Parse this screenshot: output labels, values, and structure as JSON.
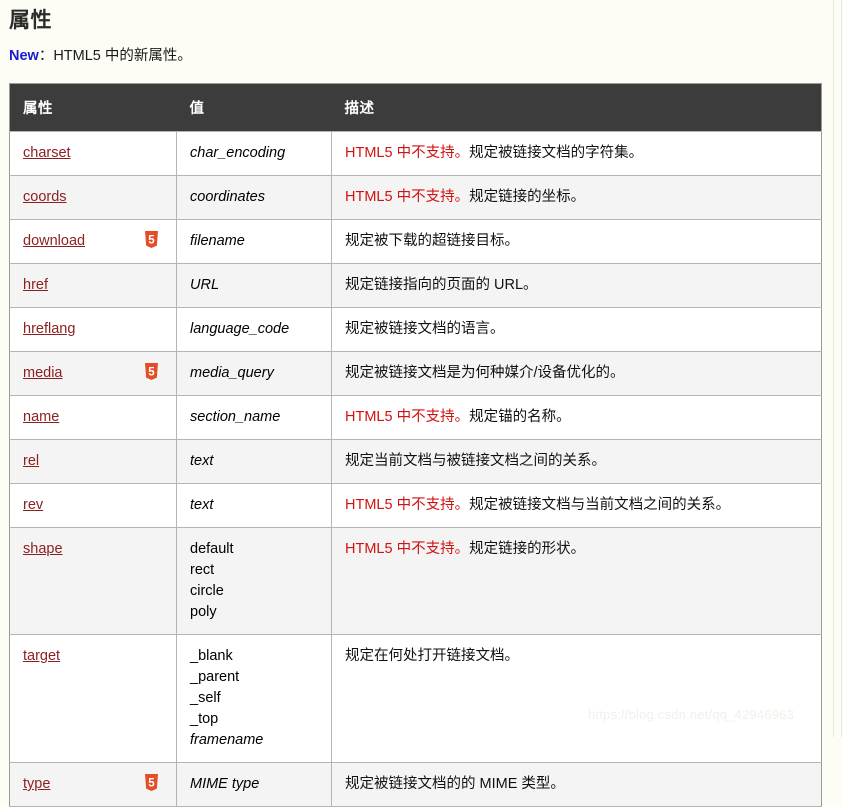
{
  "page": {
    "title": "属性",
    "new_badge": "New",
    "new_note": "：HTML5 中的新属性。",
    "watermark": "https://blog.csdn.net/qq_42946963",
    "accent_link_color": "#8c1f1f",
    "header_bg_color": "#3c3c3c",
    "not_supported_color": "#d11212",
    "new_badge_color": "#1a1ad0",
    "html5_badge_color": "#e44d26",
    "page_bg_color": "#fdfdf6"
  },
  "table": {
    "columns": [
      "属性",
      "值",
      "描述"
    ],
    "rows": [
      {
        "attr": "charset",
        "html5": false,
        "values": [
          {
            "text": "char_encoding",
            "italic": true
          }
        ],
        "ns": "HTML5 中不支持。",
        "desc": "规定被链接文档的字符集。"
      },
      {
        "attr": "coords",
        "html5": false,
        "values": [
          {
            "text": "coordinates",
            "italic": true
          }
        ],
        "ns": "HTML5 中不支持。",
        "desc": "规定链接的坐标。"
      },
      {
        "attr": "download",
        "html5": true,
        "values": [
          {
            "text": "filename",
            "italic": true
          }
        ],
        "ns": "",
        "desc": "规定被下载的超链接目标。"
      },
      {
        "attr": "href",
        "html5": false,
        "values": [
          {
            "text": "URL",
            "italic": true
          }
        ],
        "ns": "",
        "desc": "规定链接指向的页面的 URL。"
      },
      {
        "attr": "hreflang",
        "html5": false,
        "values": [
          {
            "text": "language_code",
            "italic": true
          }
        ],
        "ns": "",
        "desc": "规定被链接文档的语言。"
      },
      {
        "attr": "media",
        "html5": true,
        "values": [
          {
            "text": "media_query",
            "italic": true
          }
        ],
        "ns": "",
        "desc": "规定被链接文档是为何种媒介/设备优化的。"
      },
      {
        "attr": "name",
        "html5": false,
        "values": [
          {
            "text": "section_name",
            "italic": true
          }
        ],
        "ns": "HTML5 中不支持。",
        "desc": "规定锚的名称。"
      },
      {
        "attr": "rel",
        "html5": false,
        "values": [
          {
            "text": "text",
            "italic": true
          }
        ],
        "ns": "",
        "desc": "规定当前文档与被链接文档之间的关系。"
      },
      {
        "attr": "rev",
        "html5": false,
        "values": [
          {
            "text": "text",
            "italic": true
          }
        ],
        "ns": "HTML5 中不支持。",
        "desc": "规定被链接文档与当前文档之间的关系。"
      },
      {
        "attr": "shape",
        "html5": false,
        "values": [
          {
            "text": "default",
            "italic": false
          },
          {
            "text": "rect",
            "italic": false
          },
          {
            "text": "circle",
            "italic": false
          },
          {
            "text": "poly",
            "italic": false
          }
        ],
        "ns": "HTML5 中不支持。",
        "desc": "规定链接的形状。"
      },
      {
        "attr": "target",
        "html5": false,
        "values": [
          {
            "text": "_blank",
            "italic": false
          },
          {
            "text": "_parent",
            "italic": false
          },
          {
            "text": "_self",
            "italic": false
          },
          {
            "text": "_top",
            "italic": false
          },
          {
            "text": "framename",
            "italic": true
          }
        ],
        "ns": "",
        "desc": "规定在何处打开链接文档。"
      },
      {
        "attr": "type",
        "html5": true,
        "values": [
          {
            "text": "MIME type",
            "italic": true
          }
        ],
        "ns": "",
        "desc": "规定被链接文档的的 MIME 类型。"
      }
    ]
  }
}
